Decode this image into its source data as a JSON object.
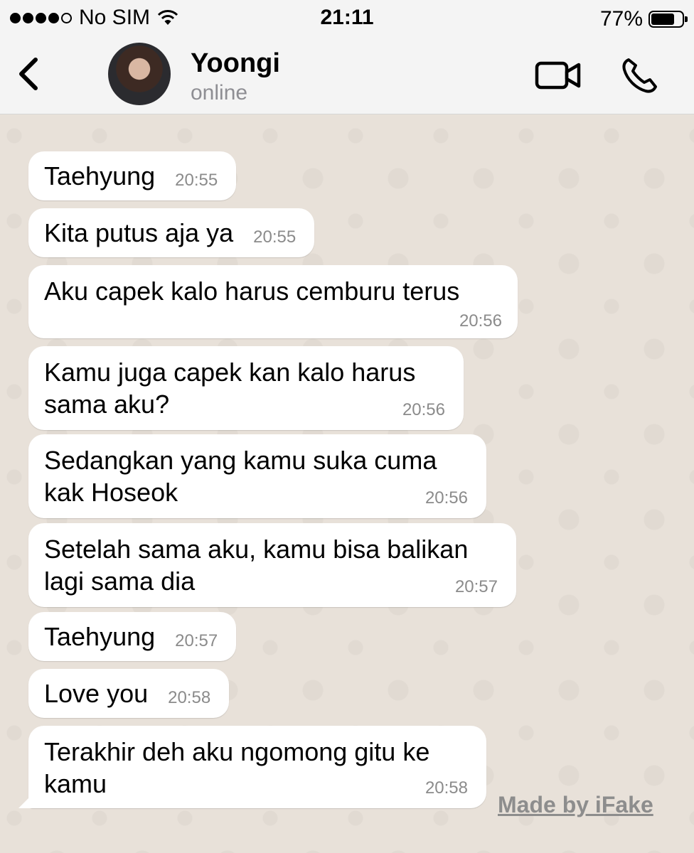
{
  "status_bar": {
    "carrier": "No SIM",
    "time": "21:11",
    "battery_percent": "77%",
    "battery_level": 0.77
  },
  "header": {
    "name": "Yoongi",
    "status": "online"
  },
  "messages": [
    {
      "text": "Taehyung",
      "time": "20:55"
    },
    {
      "text": "Kita putus aja ya",
      "time": "20:55"
    },
    {
      "text": "Aku capek kalo harus cemburu terus",
      "time": "20:56"
    },
    {
      "text": "Kamu juga capek kan kalo harus\nsama aku?",
      "time": "20:56"
    },
    {
      "text": "Sedangkan yang kamu suka cuma\nkak Hoseok",
      "time": "20:56"
    },
    {
      "text": "Setelah sama aku, kamu bisa balikan\nlagi sama dia",
      "time": "20:57"
    },
    {
      "text": "Taehyung",
      "time": "20:57"
    },
    {
      "text": "Love you",
      "time": "20:58"
    },
    {
      "text": "Terakhir deh aku ngomong gitu ke\nkamu",
      "time": "20:58"
    }
  ],
  "watermark": "Made by iFake",
  "icons": {
    "back": "chevron-left-icon",
    "video": "video-camera-icon",
    "call": "phone-icon",
    "wifi": "wifi-icon",
    "battery": "battery-icon"
  }
}
